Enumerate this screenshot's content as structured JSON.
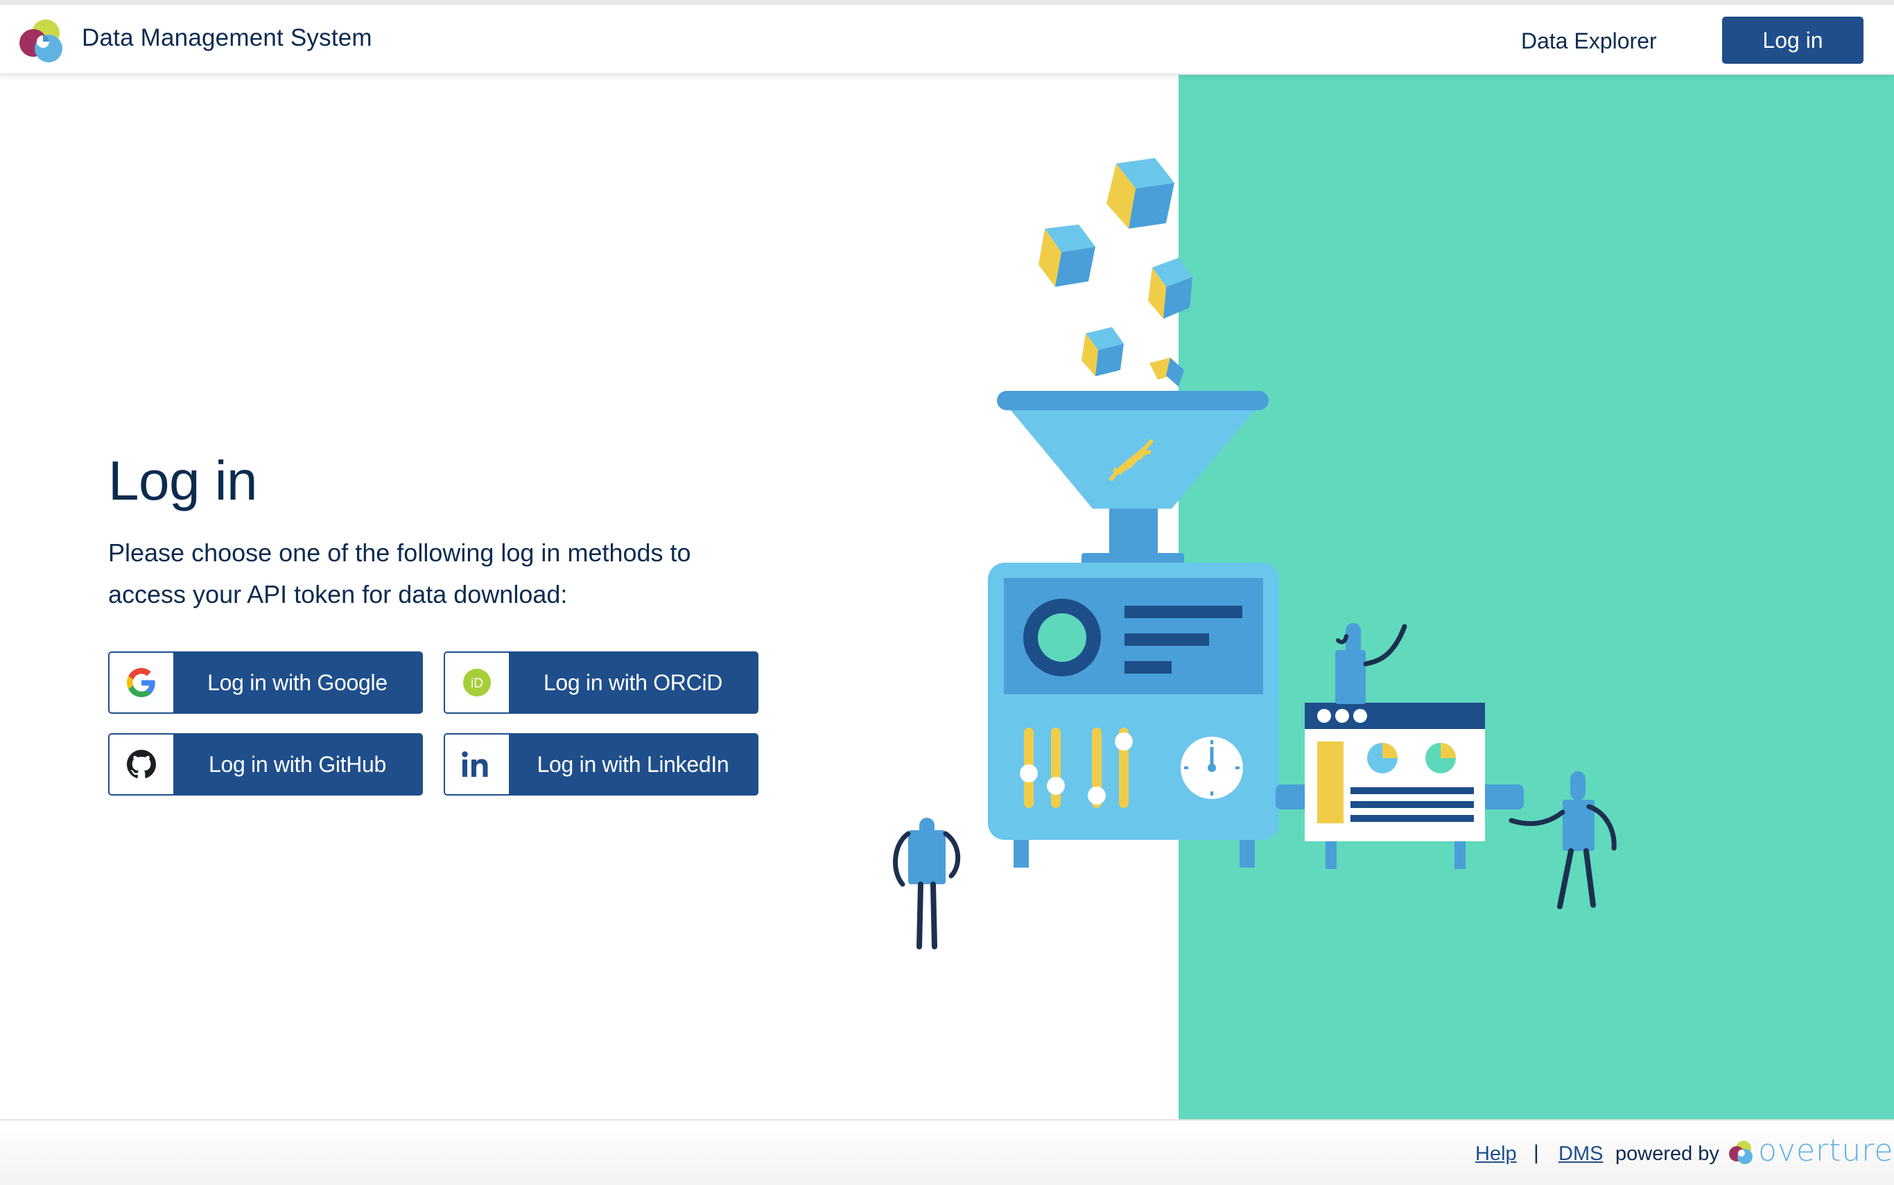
{
  "navbar": {
    "app_title": "Data Management System",
    "explorer_link": "Data Explorer",
    "login_button": "Log in",
    "logo_icon": "dms-logo-icon"
  },
  "login": {
    "heading": "Log in",
    "description": "Please choose one of the following log in methods to access your API token for data download:",
    "providers": [
      {
        "label": "Log in with Google",
        "icon": "google-icon"
      },
      {
        "label": "Log in with ORCiD",
        "icon": "orcid-icon"
      },
      {
        "label": "Log in with GitHub",
        "icon": "github-icon"
      },
      {
        "label": "Log in with LinkedIn",
        "icon": "linkedin-icon"
      }
    ]
  },
  "footer": {
    "help_link": "Help",
    "separator": "|",
    "dms_link": "DMS",
    "powered_by": "powered by",
    "brand": "overture"
  },
  "colors": {
    "primary": "#1f4e8b",
    "text": "#0b2b4f",
    "teal_panel": "#60d9bd",
    "link": "#1f4e8b"
  }
}
